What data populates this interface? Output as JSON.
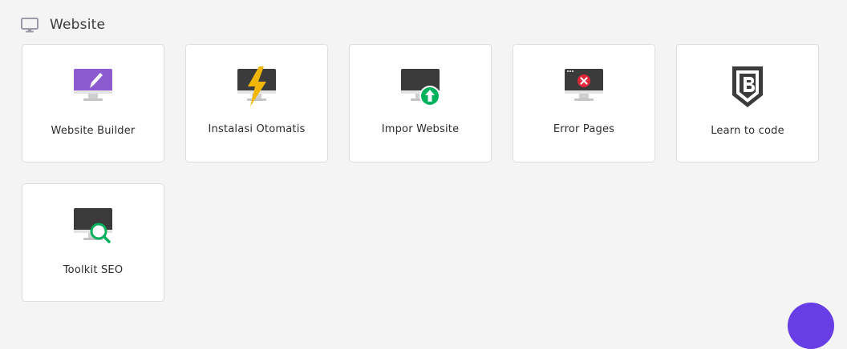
{
  "section": {
    "title": "Website",
    "icon": "monitor-icon"
  },
  "cards": [
    {
      "label": "Website Builder",
      "icon": "website-builder-icon"
    },
    {
      "label": "Instalasi Otomatis",
      "icon": "auto-installer-icon"
    },
    {
      "label": "Impor Website",
      "icon": "import-website-icon"
    },
    {
      "label": "Error Pages",
      "icon": "error-pages-icon"
    },
    {
      "label": "Learn to code",
      "icon": "learn-to-code-icon"
    },
    {
      "label": "Toolkit SEO",
      "icon": "seo-toolkit-icon"
    }
  ],
  "colors": {
    "accent": "#673de6",
    "builder_screen": "#8c5bd0",
    "bolt": "#f2b705",
    "success": "#00b15b",
    "error": "#e2263a",
    "monitor_dark": "#3b3b3b"
  }
}
